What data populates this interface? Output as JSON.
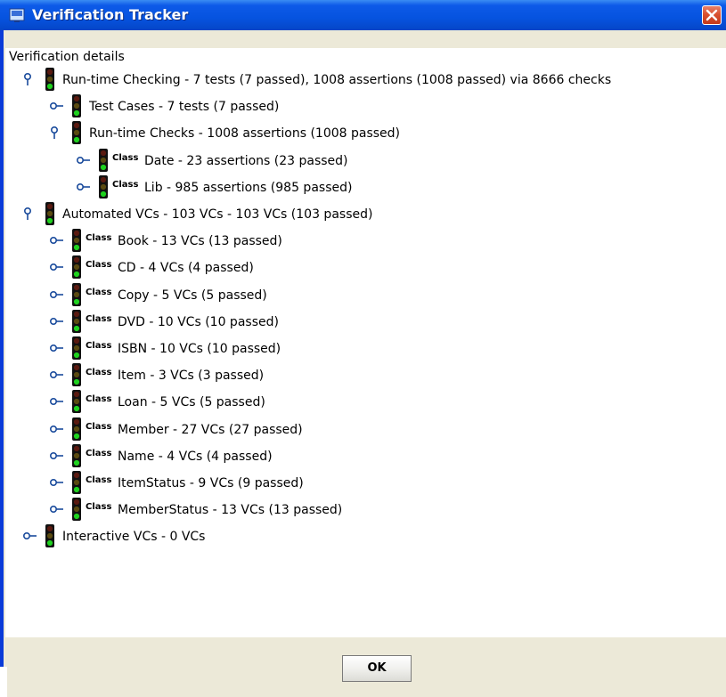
{
  "window": {
    "title": "Verification Tracker"
  },
  "tree": {
    "root_label": "Verification details",
    "nodes": [
      {
        "level": 1,
        "expanded": true,
        "has_class_tag": false,
        "label": "Run-time Checking - 7 tests (7 passed), 1008 assertions (1008 passed) via 8666 checks"
      },
      {
        "level": 2,
        "expanded": false,
        "has_class_tag": false,
        "label": "Test Cases - 7 tests (7 passed)"
      },
      {
        "level": 2,
        "expanded": true,
        "has_class_tag": false,
        "label": "Run-time Checks - 1008 assertions (1008 passed)"
      },
      {
        "level": 3,
        "expanded": false,
        "has_class_tag": true,
        "label": "Date - 23 assertions (23 passed)"
      },
      {
        "level": 3,
        "expanded": false,
        "has_class_tag": true,
        "label": "Lib - 985 assertions (985 passed)"
      },
      {
        "level": 1,
        "expanded": true,
        "has_class_tag": false,
        "label": "Automated VCs - 103 VCs - 103 VCs (103 passed)"
      },
      {
        "level": 2,
        "expanded": false,
        "has_class_tag": true,
        "label": "Book - 13 VCs (13 passed)"
      },
      {
        "level": 2,
        "expanded": false,
        "has_class_tag": true,
        "label": "CD - 4 VCs (4 passed)"
      },
      {
        "level": 2,
        "expanded": false,
        "has_class_tag": true,
        "label": "Copy - 5 VCs (5 passed)"
      },
      {
        "level": 2,
        "expanded": false,
        "has_class_tag": true,
        "label": "DVD - 10 VCs (10 passed)"
      },
      {
        "level": 2,
        "expanded": false,
        "has_class_tag": true,
        "label": "ISBN - 10 VCs (10 passed)"
      },
      {
        "level": 2,
        "expanded": false,
        "has_class_tag": true,
        "label": "Item - 3 VCs (3 passed)"
      },
      {
        "level": 2,
        "expanded": false,
        "has_class_tag": true,
        "label": "Loan - 5 VCs (5 passed)"
      },
      {
        "level": 2,
        "expanded": false,
        "has_class_tag": true,
        "label": "Member - 27 VCs (27 passed)"
      },
      {
        "level": 2,
        "expanded": false,
        "has_class_tag": true,
        "label": "Name - 4 VCs (4 passed)"
      },
      {
        "level": 2,
        "expanded": false,
        "has_class_tag": true,
        "label": "ItemStatus - 9 VCs (9 passed)"
      },
      {
        "level": 2,
        "expanded": false,
        "has_class_tag": true,
        "label": "MemberStatus - 13 VCs (13 passed)"
      },
      {
        "level": 1,
        "expanded": false,
        "has_class_tag": false,
        "label": "Interactive VCs - 0 VCs"
      }
    ],
    "class_tag_text": "Class",
    "status_icon": "traffic-light-green-icon"
  },
  "buttons": {
    "ok_label": "OK"
  },
  "colors": {
    "titlebar": "#0653df",
    "close_button": "#d9502f",
    "dialog_background": "#ece9d8",
    "light_on_green": "#1fd21f",
    "light_off_red": "#5a1a10",
    "light_off_amber": "#5a4a10"
  }
}
